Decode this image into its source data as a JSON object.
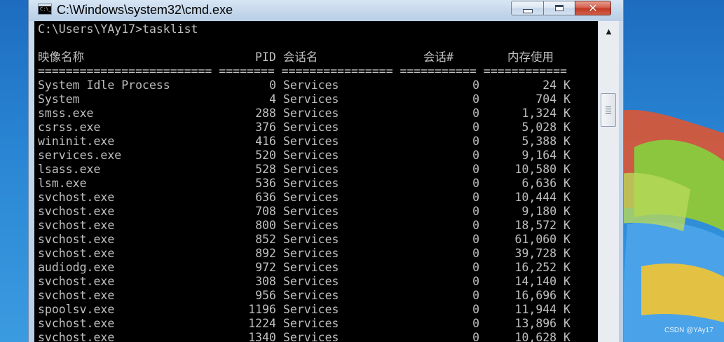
{
  "window": {
    "title": "C:\\Windows\\system32\\cmd.exe",
    "icon_glyph": "C:\\_",
    "minimize_icon": "minimize-icon",
    "maximize_icon": "maximize-icon",
    "close_label": "✕"
  },
  "console": {
    "prompt_line": "C:\\Users\\YAy17>tasklist",
    "headers": {
      "name": "映像名称",
      "pid": "PID",
      "session_name": "会话名",
      "session_num": "会话#",
      "mem": "内存使用"
    },
    "separator": "========================= ======== ================ =========== ============",
    "rows": [
      {
        "name": "System Idle Process",
        "pid": "0",
        "session": "Services",
        "num": "0",
        "mem": "24 K"
      },
      {
        "name": "System",
        "pid": "4",
        "session": "Services",
        "num": "0",
        "mem": "704 K"
      },
      {
        "name": "smss.exe",
        "pid": "288",
        "session": "Services",
        "num": "0",
        "mem": "1,324 K"
      },
      {
        "name": "csrss.exe",
        "pid": "376",
        "session": "Services",
        "num": "0",
        "mem": "5,028 K"
      },
      {
        "name": "wininit.exe",
        "pid": "416",
        "session": "Services",
        "num": "0",
        "mem": "5,388 K"
      },
      {
        "name": "services.exe",
        "pid": "520",
        "session": "Services",
        "num": "0",
        "mem": "9,164 K"
      },
      {
        "name": "lsass.exe",
        "pid": "528",
        "session": "Services",
        "num": "0",
        "mem": "10,580 K"
      },
      {
        "name": "lsm.exe",
        "pid": "536",
        "session": "Services",
        "num": "0",
        "mem": "6,636 K"
      },
      {
        "name": "svchost.exe",
        "pid": "636",
        "session": "Services",
        "num": "0",
        "mem": "10,444 K"
      },
      {
        "name": "svchost.exe",
        "pid": "708",
        "session": "Services",
        "num": "0",
        "mem": "9,180 K"
      },
      {
        "name": "svchost.exe",
        "pid": "800",
        "session": "Services",
        "num": "0",
        "mem": "18,572 K"
      },
      {
        "name": "svchost.exe",
        "pid": "852",
        "session": "Services",
        "num": "0",
        "mem": "61,060 K"
      },
      {
        "name": "svchost.exe",
        "pid": "892",
        "session": "Services",
        "num": "0",
        "mem": "39,728 K"
      },
      {
        "name": "audiodg.exe",
        "pid": "972",
        "session": "Services",
        "num": "0",
        "mem": "16,252 K"
      },
      {
        "name": "svchost.exe",
        "pid": "308",
        "session": "Services",
        "num": "0",
        "mem": "14,140 K"
      },
      {
        "name": "svchost.exe",
        "pid": "956",
        "session": "Services",
        "num": "0",
        "mem": "16,696 K"
      },
      {
        "name": "spoolsv.exe",
        "pid": "1196",
        "session": "Services",
        "num": "0",
        "mem": "11,944 K"
      },
      {
        "name": "svchost.exe",
        "pid": "1224",
        "session": "Services",
        "num": "0",
        "mem": "13,896 K"
      },
      {
        "name": "svchost.exe",
        "pid": "1340",
        "session": "Services",
        "num": "0",
        "mem": "10,628 K"
      }
    ]
  },
  "scrollbar": {
    "up_arrow": "▲",
    "up_icon": "scroll-up-arrow-icon"
  },
  "watermark": "CSDN @YAy17",
  "colors": {
    "console_bg": "#000000",
    "console_text": "#c0c0c0",
    "close_button": "#c23a23",
    "desktop": "#1f6fb8"
  }
}
